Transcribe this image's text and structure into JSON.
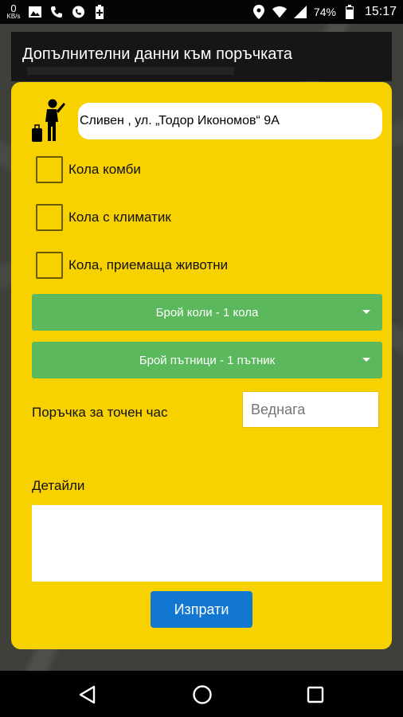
{
  "status_bar": {
    "speed_value": "0",
    "speed_unit": "KB/s",
    "battery_percent": "74%",
    "time": "15:17",
    "icons": [
      "image-icon",
      "call-icon",
      "viber-icon",
      "battery-saver-icon",
      "location-icon",
      "wifi-icon",
      "signal-icon",
      "battery-icon"
    ]
  },
  "dialog": {
    "title": "Допълнителни данни към поръчката"
  },
  "form": {
    "address": "Сливен , ул. „Тодор Икономов“ 9А",
    "options": [
      {
        "label": "Кола комби",
        "checked": false
      },
      {
        "label": "Кола с климатик",
        "checked": false
      },
      {
        "label": "Кола, приемаща животни",
        "checked": false
      }
    ],
    "cars_select": "Брой коли - 1 кола",
    "passengers_select": "Брой пътници - 1 пътник",
    "time_label": "Поръчка за точен час",
    "time_placeholder": "Веднага",
    "details_label": "Детайли",
    "details_value": "",
    "send_label": "Изпрати"
  },
  "colors": {
    "card": "#f7d100",
    "select": "#5cb85c",
    "send": "#1177d1"
  }
}
